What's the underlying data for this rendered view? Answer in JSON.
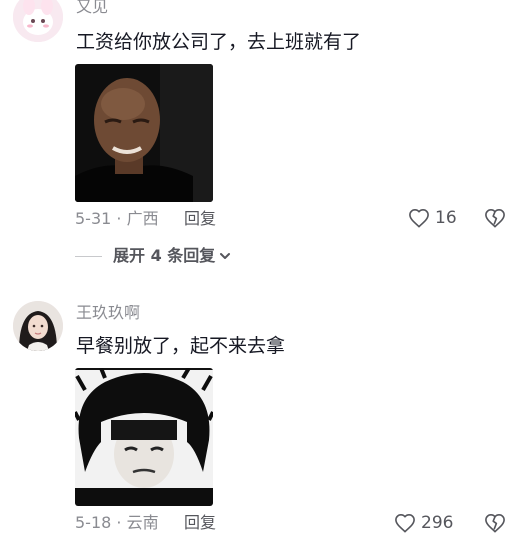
{
  "comments": [
    {
      "username": "又见",
      "text": "工资给你放公司了，去上班就有了",
      "date_location": "5-31 · 广西",
      "reply_label": "回复",
      "likes": "16"
    },
    {
      "username": "王玖玖啊",
      "text": "早餐别放了，起不来去拿",
      "date_location": "5-18 · 云南",
      "reply_label": "回复",
      "likes": "296"
    }
  ],
  "expand_replies_label": "展开 4 条回复",
  "icons": {
    "like": "heart-outline-icon",
    "dislike": "broken-heart-icon",
    "expand": "chevron-down-icon"
  },
  "colors": {
    "text_primary": "#161823",
    "text_secondary": "#8a8b91",
    "action": "#55565c"
  }
}
